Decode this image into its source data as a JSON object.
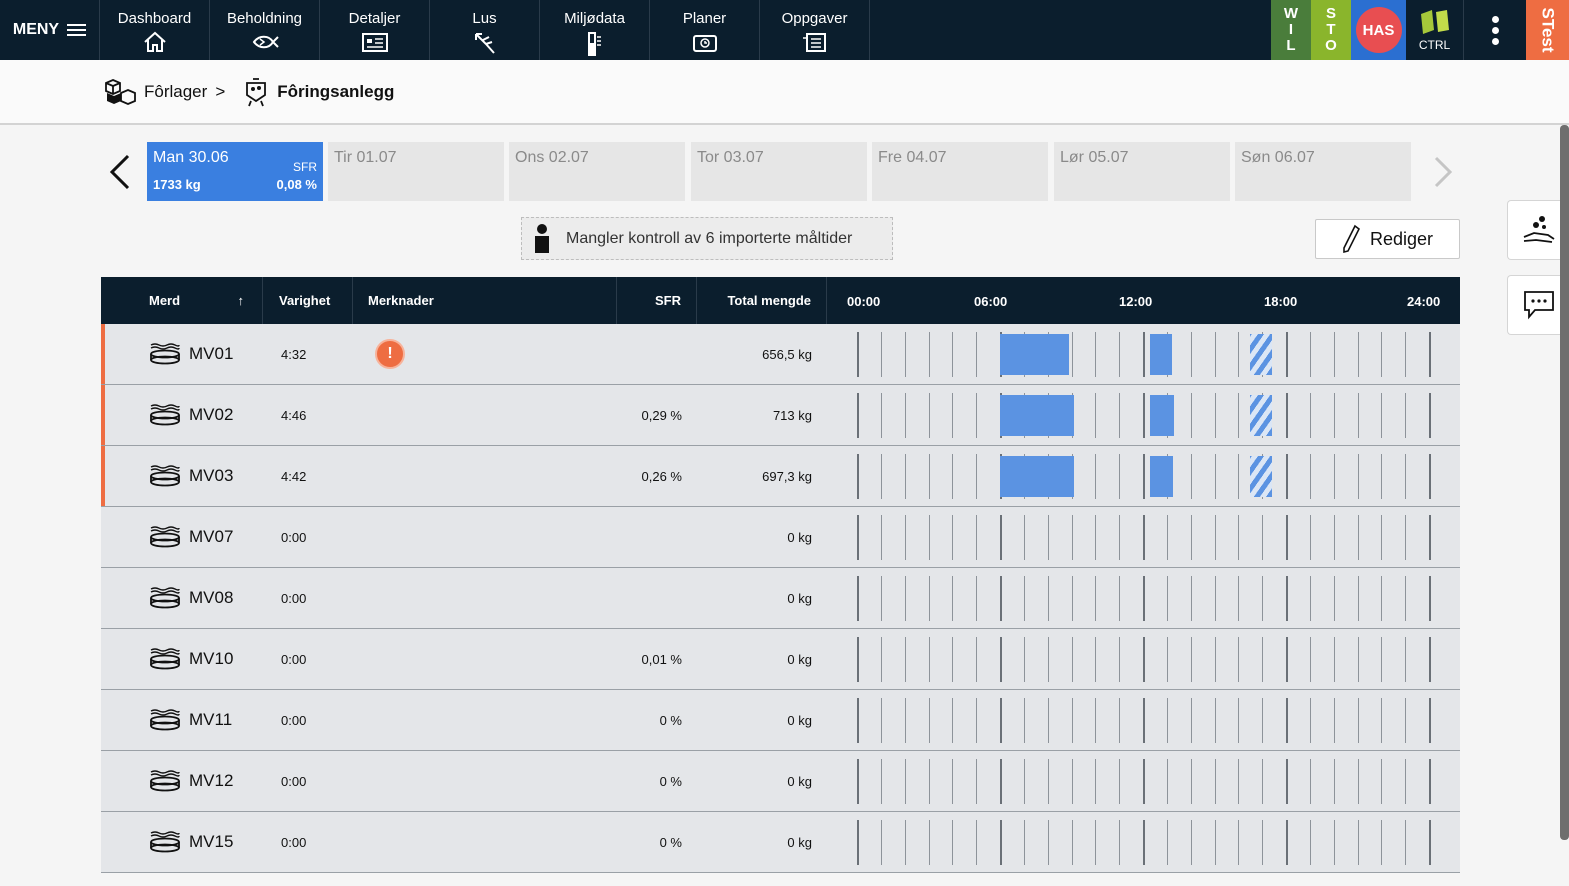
{
  "nav": {
    "menu_label": "MENY",
    "items": [
      {
        "label": "Dashboard",
        "icon": "home-icon"
      },
      {
        "label": "Beholdning",
        "icon": "fish-icon"
      },
      {
        "label": "Detaljer",
        "icon": "details-card-icon"
      },
      {
        "label": "Lus",
        "icon": "lice-icon"
      },
      {
        "label": "Miljødata",
        "icon": "thermometer-icon"
      },
      {
        "label": "Planer",
        "icon": "plans-icon"
      },
      {
        "label": "Oppgaver",
        "icon": "tasks-icon"
      }
    ],
    "tag_w": [
      "W",
      "I",
      "L"
    ],
    "tag_s": [
      "S",
      "T",
      "O"
    ],
    "user_initials": "HAS",
    "ctrl_label": "CTRL",
    "env_label": "STest"
  },
  "breadcrumb": {
    "parent": "Fôrlager",
    "separator": ">",
    "current": "Fôringsanlegg"
  },
  "days": [
    {
      "label": "Man 30.06",
      "sfr_label": "SFR",
      "kg": "1733 kg",
      "pct": "0,08 %",
      "active": true
    },
    {
      "label": "Tir 01.07"
    },
    {
      "label": "Ons 02.07"
    },
    {
      "label": "Tor 03.07"
    },
    {
      "label": "Fre 04.07"
    },
    {
      "label": "Lør 05.07"
    },
    {
      "label": "Søn 06.07"
    }
  ],
  "notice": "Mangler kontroll av 6 importerte måltider",
  "edit_label": "Rediger",
  "table": {
    "headers": {
      "merd": "Merd",
      "sort_arrow": "↑",
      "varighet": "Varighet",
      "merknader": "Merknader",
      "sfr": "SFR",
      "total": "Total mengde"
    },
    "time_labels": [
      "00:00",
      "06:00",
      "12:00",
      "18:00",
      "24:00"
    ],
    "rows": [
      {
        "merd": "MV01",
        "varighet": "4:32",
        "warning": true,
        "warning_symbol": "!",
        "sfr": "",
        "total": "656,5 kg",
        "flag": true,
        "blocks": [
          {
            "start": 6.0,
            "end": 8.9
          },
          {
            "start": 12.3,
            "end": 13.2
          },
          {
            "start": 16.5,
            "end": 17.4,
            "hatch": true
          }
        ]
      },
      {
        "merd": "MV02",
        "varighet": "4:46",
        "sfr": "0,29 %",
        "total": "713 kg",
        "flag": true,
        "blocks": [
          {
            "start": 6.0,
            "end": 9.1
          },
          {
            "start": 12.3,
            "end": 13.3
          },
          {
            "start": 16.5,
            "end": 17.4,
            "hatch": true
          }
        ]
      },
      {
        "merd": "MV03",
        "varighet": "4:42",
        "sfr": "0,26 %",
        "total": "697,3 kg",
        "flag": true,
        "blocks": [
          {
            "start": 6.0,
            "end": 9.1
          },
          {
            "start": 12.3,
            "end": 13.25
          },
          {
            "start": 16.5,
            "end": 17.4,
            "hatch": true
          }
        ]
      },
      {
        "merd": "MV07",
        "varighet": "0:00",
        "sfr": "",
        "total": "0 kg",
        "blocks": []
      },
      {
        "merd": "MV08",
        "varighet": "0:00",
        "sfr": "",
        "total": "0 kg",
        "blocks": []
      },
      {
        "merd": "MV10",
        "varighet": "0:00",
        "sfr": "0,01 %",
        "total": "0 kg",
        "blocks": []
      },
      {
        "merd": "MV11",
        "varighet": "0:00",
        "sfr": "0 %",
        "total": "0 kg",
        "blocks": []
      },
      {
        "merd": "MV12",
        "varighet": "0:00",
        "sfr": "0 %",
        "total": "0 kg",
        "blocks": []
      },
      {
        "merd": "MV15",
        "varighet": "0:00",
        "sfr": "0 %",
        "total": "0 kg",
        "blocks": []
      }
    ]
  },
  "colors": {
    "nav_bg": "#0b1e2d",
    "accent_blue": "#3a7fe0",
    "feeding_block": "#5b93e2",
    "warning_orange": "#ee6d42",
    "tag_w": "#4a7d3b",
    "tag_s": "#8ab52c",
    "user_red": "#e84e51"
  }
}
